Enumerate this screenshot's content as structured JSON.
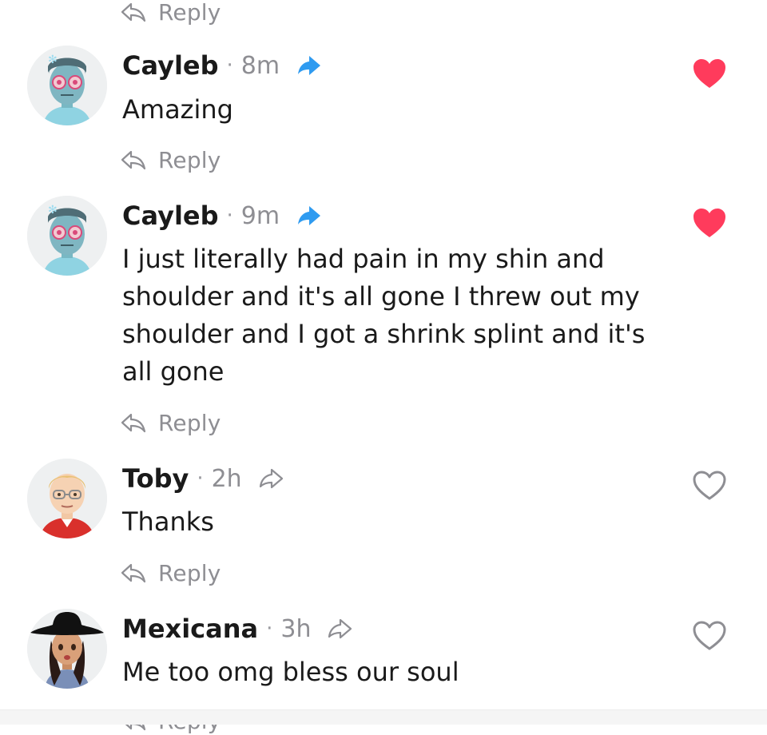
{
  "reply_label": "Reply",
  "colors": {
    "liked_heart": "#ff3b5c",
    "share_active": "#2f9bf0",
    "muted_text": "#8e8e93"
  },
  "comments": [
    {
      "author": "Cayleb",
      "time": "8m",
      "text": "Amazing",
      "liked": true,
      "share_icon": "share-arrow-filled-icon",
      "avatar": "bitmoji-avatar-cayleb"
    },
    {
      "author": "Cayleb",
      "time": "9m",
      "text": "I just literally had pain in my shin and shoulder and it's all gone I threw out my shoulder and I got a shrink splint and it's all gone",
      "liked": true,
      "share_icon": "share-arrow-filled-icon",
      "avatar": "bitmoji-avatar-cayleb"
    },
    {
      "author": "Toby",
      "time": "2h",
      "text": "Thanks",
      "liked": false,
      "share_icon": "share-arrow-outline-icon",
      "avatar": "bitmoji-avatar-toby"
    },
    {
      "author": "Mexicana",
      "time": "3h",
      "text": "Me too omg bless our soul",
      "liked": false,
      "share_icon": "share-arrow-outline-icon",
      "avatar": "bitmoji-avatar-mexicana"
    }
  ]
}
